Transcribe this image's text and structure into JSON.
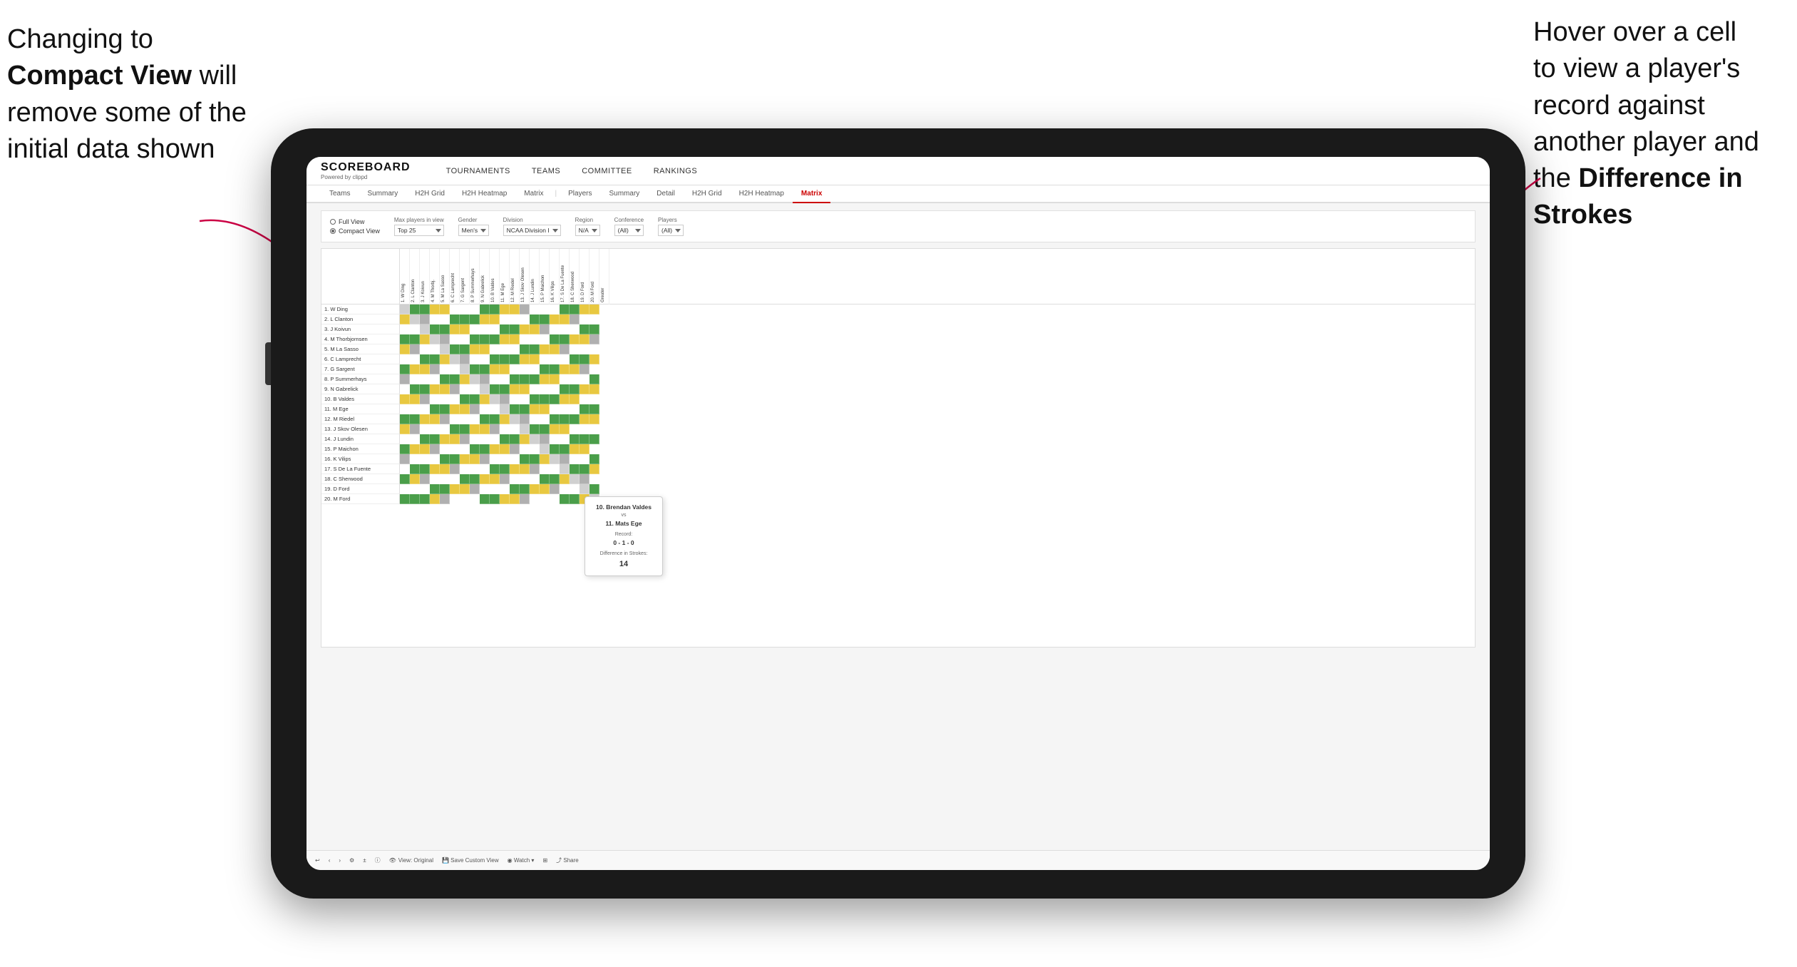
{
  "annotations": {
    "left": {
      "line1": "Changing to",
      "line2_plain": "",
      "line2_bold": "Compact View",
      "line2_suffix": " will",
      "line3": "remove some of the",
      "line4": "initial data shown"
    },
    "right": {
      "line1": "Hover over a cell",
      "line2": "to view a player's",
      "line3": "record against",
      "line4": "another player and",
      "line5_plain": "the ",
      "line5_bold": "Difference in",
      "line6_bold": "Strokes"
    }
  },
  "app": {
    "logo": "SCOREBOARD",
    "logo_sub": "Powered by clippd",
    "nav": [
      "TOURNAMENTS",
      "TEAMS",
      "COMMITTEE",
      "RANKINGS"
    ],
    "sub_nav": [
      "Teams",
      "Summary",
      "H2H Grid",
      "H2H Heatmap",
      "Matrix",
      "Players",
      "Summary",
      "Detail",
      "H2H Grid",
      "H2H Heatmap",
      "Matrix"
    ],
    "active_tab": "Matrix"
  },
  "filters": {
    "view_options": [
      "Full View",
      "Compact View"
    ],
    "selected_view": "Compact View",
    "max_players_label": "Max players in view",
    "max_players_value": "Top 25",
    "gender_label": "Gender",
    "gender_value": "Men's",
    "division_label": "Division",
    "division_value": "NCAA Division I",
    "region_label": "Region",
    "region_value": "N/A",
    "conference_label": "Conference",
    "conference_value": "(All)",
    "players_label": "Players",
    "players_value": "(All)"
  },
  "players": [
    "1. W Ding",
    "2. L Clanton",
    "3. J Koivun",
    "4. M Thorbjornsen",
    "5. M La Sasso",
    "6. C Lamprecht",
    "7. G Sargent",
    "8. P Summerhays",
    "9. N Gabrelick",
    "10. B Valdes",
    "11. M Ege",
    "12. M Riedel",
    "13. J Skov Olesen",
    "14. J Lundin",
    "15. P Maichon",
    "16. K Vilips",
    "17. S De La Fuente",
    "18. C Sherwood",
    "19. D Ford",
    "20. M Ford"
  ],
  "col_headers": [
    "1. W Ding",
    "2. L Clanton",
    "3. J Koivun",
    "4. M Thorbj.",
    "5. M La Sasso",
    "6. C Lamprecht",
    "7. G Sargent",
    "8. P Summerhays",
    "9. N Gabrelick",
    "10. B Valdes",
    "11. M Ege",
    "12. M Riedel",
    "13. J Skov Olesen",
    "14. J Lundin",
    "15. P Maichon",
    "16. K Vilips",
    "17. S De La Fuente",
    "18. C Sherwood",
    "19. D Ford",
    "20. M Ford",
    "Greater"
  ],
  "tooltip": {
    "player1": "10. Brendan Valdes",
    "vs": "vs",
    "player2": "11. Mats Ege",
    "record_label": "Record:",
    "record": "0 - 1 - 0",
    "diff_label": "Difference in Strokes:",
    "diff": "14"
  },
  "toolbar": {
    "view_original": "View: Original",
    "save_custom": "Save Custom View",
    "watch": "Watch",
    "share": "Share"
  }
}
